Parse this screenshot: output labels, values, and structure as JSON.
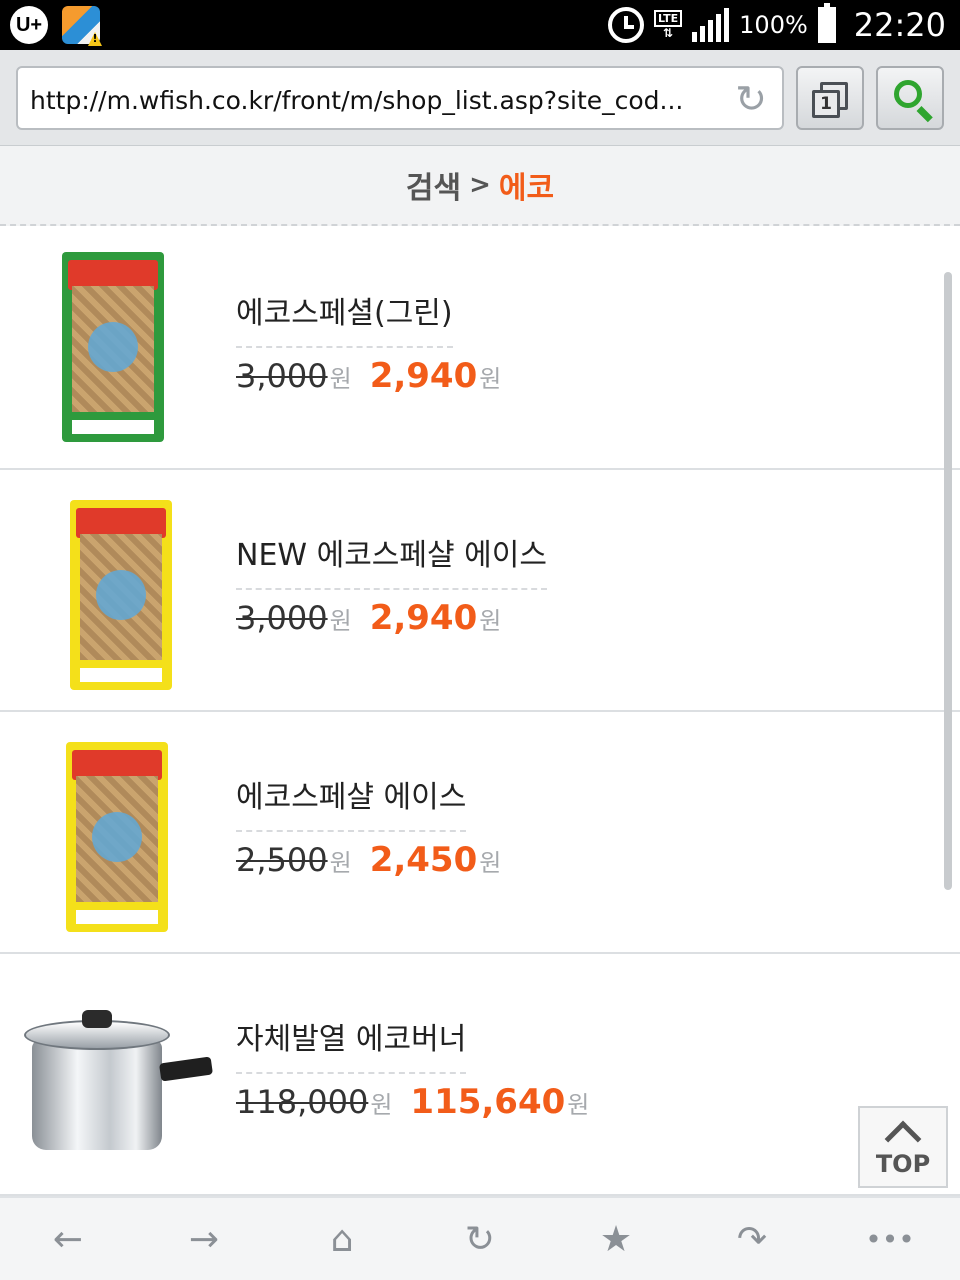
{
  "status_bar": {
    "carrier_logo": "U+",
    "lte_label": "LTE",
    "battery": "100%",
    "time": "22:20",
    "icons": [
      "u-plus-logo-icon",
      "notification-app-icon",
      "alarm-icon",
      "lte-data-icon",
      "signal-icon",
      "battery-icon"
    ]
  },
  "url_bar": {
    "url": "http://m.wfish.co.kr/front/m/shop_list.asp?site_cod...",
    "tab_count": "1",
    "icons": [
      "refresh-icon",
      "tabs-icon",
      "search-icon"
    ]
  },
  "breadcrumb": {
    "home": "검색",
    "separator": ">",
    "current": "에코"
  },
  "products": [
    {
      "name": "에코스페셜(그린)",
      "original_price": "3,000",
      "sale_price": "2,940",
      "currency": "원"
    },
    {
      "name": "NEW 에코스페샬 에이스",
      "original_price": "3,000",
      "sale_price": "2,940",
      "currency": "원"
    },
    {
      "name": "에코스페샬 에이스",
      "original_price": "2,500",
      "sale_price": "2,450",
      "currency": "원"
    },
    {
      "name": "자체발열 에코버너",
      "original_price": "118,000",
      "sale_price": "115,640",
      "currency": "원"
    }
  ],
  "top_button": {
    "label": "TOP"
  },
  "toolbar": {
    "icons": [
      "back-icon",
      "forward-icon",
      "home-icon",
      "reload-icon",
      "bookmark-star-icon",
      "share-icon",
      "more-icon"
    ],
    "glyphs": [
      "←",
      "→",
      "⌂",
      "↻",
      "★",
      "↷",
      "•••"
    ]
  },
  "colors": {
    "accent": "#f25c19",
    "search_green": "#2fa52f"
  }
}
